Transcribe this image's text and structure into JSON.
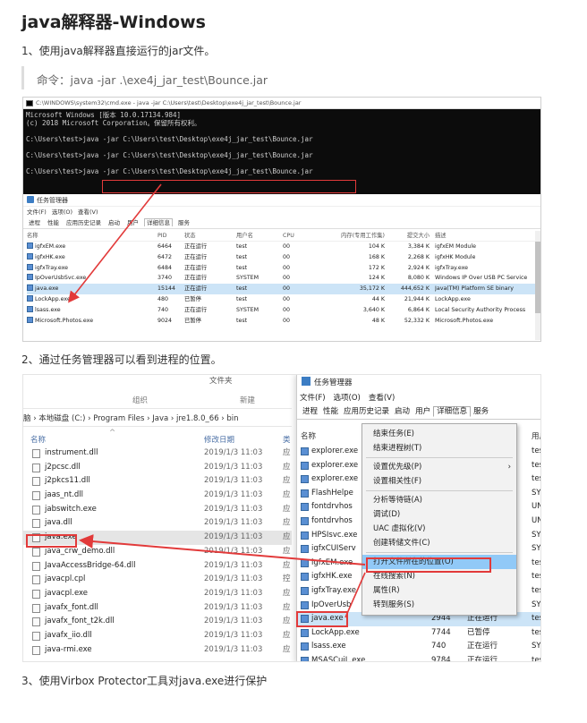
{
  "title": "java解释器-Windows",
  "step1": "1、使用java解释器直接运行的jar文件。",
  "command_quote": "命令：java -jar .\\exe4j_jar_test\\Bounce.jar",
  "step2": "2、通过任务管理器可以看到进程的位置。",
  "step3": "3、使用Virbox Protector工具对java.exe进行保护",
  "shot1": {
    "cmd_title": "C:\\WINDOWS\\system32\\cmd.exe - java  -jar C:\\Users\\test\\Desktop\\exe4j_jar_test\\Bounce.jar",
    "cmd_lines": [
      "Microsoft Windows [版本 10.0.17134.984]",
      "(c) 2018 Microsoft Corporation。保留所有权利。",
      "",
      "C:\\Users\\test>java -jar C:\\Users\\test\\Desktop\\exe4j_jar_test\\Bounce.jar",
      "",
      "C:\\Users\\test>java -jar C:\\Users\\test\\Desktop\\exe4j_jar_test\\Bounce.jar",
      "",
      "C:\\Users\\test>java -jar C:\\Users\\test\\Desktop\\exe4j_jar_test\\Bounce.jar"
    ],
    "tm_title": "任务管理器",
    "tm_menu": [
      "文件(F)",
      "选项(O)",
      "查看(V)"
    ],
    "tm_tabs": [
      "进程",
      "性能",
      "应用历史记录",
      "启动",
      "用户",
      "详细信息",
      "服务"
    ],
    "tm_active_tab": "详细信息",
    "columns": [
      "名称",
      "PID",
      "状态",
      "用户名",
      "CPU",
      "内存(专用工作集)",
      "提交大小",
      "描述"
    ],
    "rows": [
      {
        "name": "igfxEM.exe",
        "pid": "6464",
        "status": "正在运行",
        "user": "test",
        "cpu": "00",
        "mem": "104 K",
        "commit": "3,384 K",
        "desc": "igfxEM Module"
      },
      {
        "name": "igfxHK.exe",
        "pid": "6472",
        "status": "正在运行",
        "user": "test",
        "cpu": "00",
        "mem": "168 K",
        "commit": "2,268 K",
        "desc": "igfxHK Module"
      },
      {
        "name": "igfxTray.exe",
        "pid": "6484",
        "status": "正在运行",
        "user": "test",
        "cpu": "00",
        "mem": "172 K",
        "commit": "2,924 K",
        "desc": "igfxTray.exe"
      },
      {
        "name": "IpOverUsbSvc.exe",
        "pid": "3740",
        "status": "正在运行",
        "user": "SYSTEM",
        "cpu": "00",
        "mem": "124 K",
        "commit": "8,080 K",
        "desc": "Windows IP Over USB PC Service"
      },
      {
        "name": "java.exe",
        "pid": "15144",
        "status": "正在运行",
        "user": "test",
        "cpu": "00",
        "mem": "35,172 K",
        "commit": "444,652 K",
        "desc": "Java(TM) Platform SE binary"
      },
      {
        "name": "LockApp.exe",
        "pid": "480",
        "status": "已暂停",
        "user": "test",
        "cpu": "00",
        "mem": "44 K",
        "commit": "21,944 K",
        "desc": "LockApp.exe"
      },
      {
        "name": "lsass.exe",
        "pid": "740",
        "status": "正在运行",
        "user": "SYSTEM",
        "cpu": "00",
        "mem": "3,640 K",
        "commit": "6,864 K",
        "desc": "Local Security Authority Process"
      },
      {
        "name": "Microsoft.Photos.exe",
        "pid": "9024",
        "status": "已暂停",
        "user": "test",
        "cpu": "00",
        "mem": "48 K",
        "commit": "52,332 K",
        "desc": "Microsoft.Photos.exe"
      }
    ]
  },
  "shot2": {
    "ribbon_new": "文件夹",
    "ribbon_group1": "组织",
    "ribbon_group2": "新建",
    "path": "脑 › 本地磁盘 (C:) › Program Files › Java › jre1.8.0_66 › bin",
    "col_name": "名称",
    "col_date": "修改日期",
    "col_type": "类",
    "files": [
      {
        "name": "instrument.dll",
        "date": "2019/1/3 11:03",
        "type": "应"
      },
      {
        "name": "j2pcsc.dll",
        "date": "2019/1/3 11:03",
        "type": "应"
      },
      {
        "name": "j2pkcs11.dll",
        "date": "2019/1/3 11:03",
        "type": "应"
      },
      {
        "name": "jaas_nt.dll",
        "date": "2019/1/3 11:03",
        "type": "应"
      },
      {
        "name": "jabswitch.exe",
        "date": "2019/1/3 11:03",
        "type": "应"
      },
      {
        "name": "java.dll",
        "date": "2019/1/3 11:03",
        "type": "应"
      },
      {
        "name": "java.exe",
        "date": "2019/1/3 11:03",
        "type": "应"
      },
      {
        "name": "java_crw_demo.dll",
        "date": "2019/1/3 11:03",
        "type": "应"
      },
      {
        "name": "JavaAccessBridge-64.dll",
        "date": "2019/1/3 11:03",
        "type": "应"
      },
      {
        "name": "javacpl.cpl",
        "date": "2019/1/3 11:03",
        "type": "控"
      },
      {
        "name": "javacpl.exe",
        "date": "2019/1/3 11:03",
        "type": "应"
      },
      {
        "name": "javafx_font.dll",
        "date": "2019/1/3 11:03",
        "type": "应"
      },
      {
        "name": "javafx_font_t2k.dll",
        "date": "2019/1/3 11:03",
        "type": "应"
      },
      {
        "name": "javafx_iio.dll",
        "date": "2019/1/3 11:03",
        "type": "应"
      },
      {
        "name": "java-rmi.exe",
        "date": "2019/1/3 11:03",
        "type": "应"
      }
    ],
    "tm_title": "任务管理器",
    "tm_menu": [
      "文件(F)",
      "选项(O)",
      "查看(V)"
    ],
    "tm_tabs": [
      "进程",
      "性能",
      "应用历史记录",
      "启动",
      "用户",
      "详细信息",
      "服务"
    ],
    "tm_col_name": "名称",
    "tm_col_user": "用户",
    "tm_rows": [
      {
        "name": "explorer.exe",
        "pid": "",
        "status": "",
        "user": "tes"
      },
      {
        "name": "explorer.exe",
        "pid": "",
        "status": "",
        "user": "tes"
      },
      {
        "name": "explorer.exe",
        "pid": "",
        "status": "",
        "user": "tes"
      },
      {
        "name": "FlashHelpe",
        "pid": "",
        "status": "",
        "user": "SY"
      },
      {
        "name": "fontdrvhos",
        "pid": "",
        "status": "",
        "user": "UN"
      },
      {
        "name": "fontdrvhos",
        "pid": "",
        "status": "",
        "user": "UN"
      },
      {
        "name": "HPSIsvc.exe",
        "pid": "",
        "status": "",
        "user": "SY"
      },
      {
        "name": "igfxCUIServ",
        "pid": "",
        "status": "",
        "user": "SY"
      },
      {
        "name": "igfxEM.exe",
        "pid": "",
        "status": "",
        "user": "tes"
      },
      {
        "name": "igfxHK.exe",
        "pid": "",
        "status": "",
        "user": "tes"
      },
      {
        "name": "igfxTray.exe",
        "pid": "",
        "status": "",
        "user": "tes"
      },
      {
        "name": "IpOverUsb",
        "pid": "",
        "status": "",
        "user": "SY"
      },
      {
        "name": "java.exe",
        "pid": "2944",
        "status": "正在运行",
        "user": "tes"
      },
      {
        "name": "LockApp.exe",
        "pid": "7744",
        "status": "已暂停",
        "user": "tes"
      },
      {
        "name": "lsass.exe",
        "pid": "740",
        "status": "正在运行",
        "user": "SY"
      },
      {
        "name": "MSASCuiL.exe",
        "pid": "9784",
        "status": "正在运行",
        "user": "tes"
      }
    ],
    "context_menu": [
      "结束任务(E)",
      "结束进程树(T)",
      "-",
      "设置优先级(P)",
      "设置相关性(F)",
      "-",
      "分析等待链(A)",
      "调试(D)",
      "UAC 虚拟化(V)",
      "创建转储文件(C)",
      "-",
      "打开文件所在的位置(O)",
      "在线搜索(N)",
      "属性(R)",
      "转到服务(S)"
    ],
    "context_highlight": "打开文件所在的位置(O)"
  },
  "accent_red": "#e23a3a",
  "selection_blue": "#cce4f7"
}
